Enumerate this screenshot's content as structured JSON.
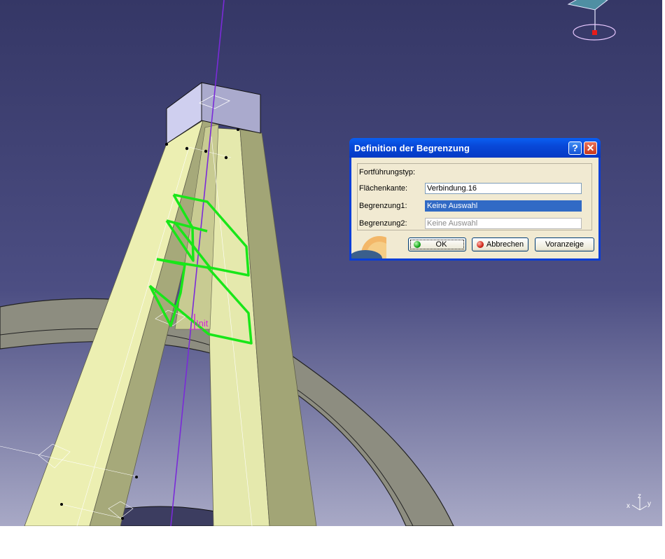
{
  "dialog": {
    "title": "Definition der Begrenzung",
    "help_symbol": "?",
    "close_symbol": "✕",
    "fields": {
      "fortfuehrungstyp_label": "Fortführungstyp:",
      "flaechenkante_label": "Flächenkante:",
      "flaechenkante_value": "Verbindung.16",
      "begrenzung1_label": "Begrenzung1:",
      "begrenzung1_value": "Keine Auswahl",
      "begrenzung2_label": "Begrenzung2:",
      "begrenzung2_value": "Keine Auswahl"
    },
    "buttons": {
      "ok": "OK",
      "abbrechen": "Abbrechen",
      "voranzeige": "Voranzeige"
    }
  },
  "viewport": {
    "annotation": "Init",
    "axis_z": "z",
    "axis_x": "x",
    "axis_y": "y",
    "colors": {
      "background_top": "#353766",
      "background_bottom": "#a8a9c6",
      "surface_light": "#ecefb2",
      "surface_dark": "#a2a576",
      "highlight": "#19e619",
      "axis_line": "#7a2bd8",
      "annotation": "#d423d4"
    }
  },
  "icons": [
    "help-icon",
    "close-icon",
    "ok-green-ball-icon",
    "cancel-red-ball-icon",
    "compass-icon",
    "axis-triad-icon"
  ]
}
